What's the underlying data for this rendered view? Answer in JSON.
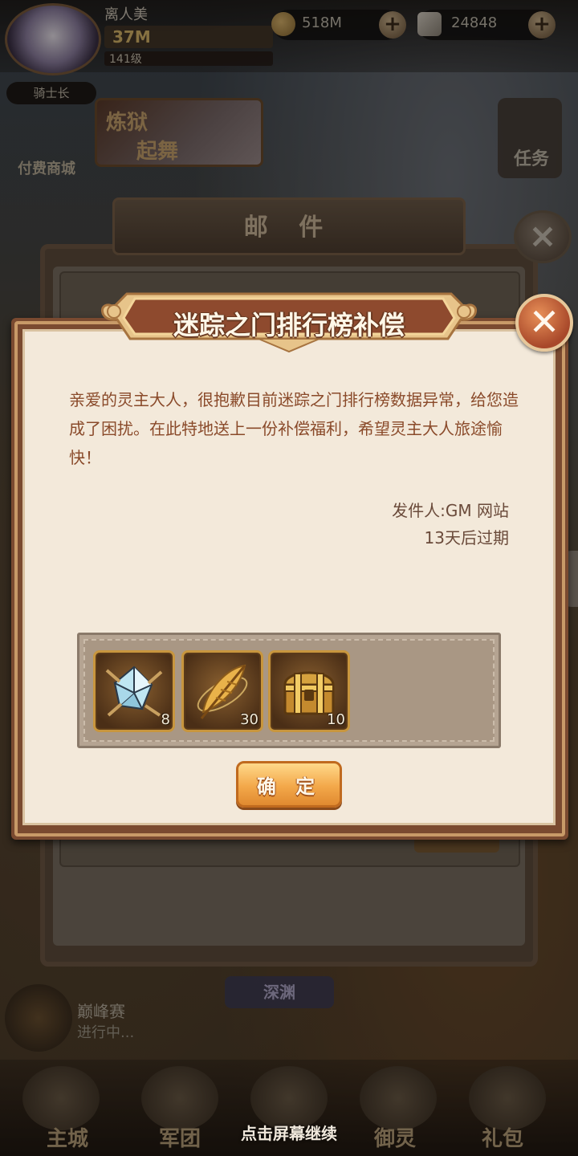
{
  "hud": {
    "player_name": "离人美",
    "power": "37M",
    "level": "141级",
    "rank": "骑士长",
    "gold": "518M",
    "gems": "24848"
  },
  "side": {
    "shop_label": "付费商城",
    "banner_line1": "炼狱",
    "banner_line2": "起舞",
    "task_label": "任务"
  },
  "mail_dialog": {
    "title": "邮 件"
  },
  "popup": {
    "title": "迷踪之门排行榜补偿",
    "body": "亲爱的灵主大人，很抱歉目前迷踪之门排行榜数据异常，给您造成了困扰。在此特地送上一份补偿福利，希望灵主大人旅途愉快！",
    "sender": "发件人:GM 网站",
    "expire": "13天后过期",
    "confirm": "确 定",
    "rewards": [
      {
        "icon": "crystal-shard-icon",
        "count": "8"
      },
      {
        "icon": "golden-feather-icon",
        "count": "30"
      },
      {
        "icon": "treasure-chest-icon",
        "count": "10"
      }
    ]
  },
  "bottom": {
    "peak_label": "巅峰赛",
    "peak_status": "进行中...",
    "abyss": "深渊",
    "nav": [
      "主城",
      "军团",
      "",
      "御灵",
      "礼包"
    ],
    "continue": "点击屏幕继续"
  },
  "colors": {
    "popup_bg": "#f3e9da",
    "body_text": "#8a4a2a",
    "confirm_button": "#f3a84a"
  }
}
